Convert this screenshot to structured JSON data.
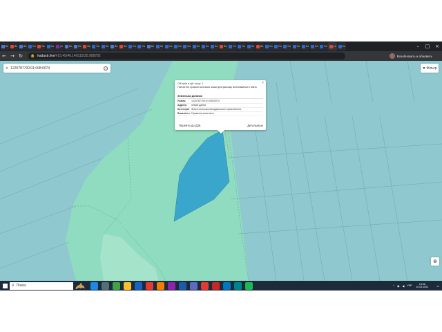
{
  "browser": {
    "tabs": [
      {
        "label": "Ва",
        "color": "#4a7bd6"
      },
      {
        "label": "Ва",
        "color": "#d84a3a"
      },
      {
        "label": "Ва",
        "color": "#4a7bd6"
      },
      {
        "label": "Ка",
        "color": "#2b6ad6"
      },
      {
        "label": "Ва",
        "color": "#d84a3a"
      },
      {
        "label": "Ка",
        "color": "#2b6ad6"
      },
      {
        "label": "Jd",
        "color": "#8e24aa"
      },
      {
        "label": "Ва",
        "color": "#4a7bd6"
      },
      {
        "label": "Ва",
        "color": "#4a7bd6"
      },
      {
        "label": "Ва",
        "color": "#d84a3a"
      },
      {
        "label": "Ка",
        "color": "#2b6ad6"
      },
      {
        "label": "Ка",
        "color": "#2b6ad6"
      },
      {
        "label": "Ва",
        "color": "#4a7bd6"
      },
      {
        "label": "Ва",
        "color": "#d84a3a"
      },
      {
        "label": "Ка",
        "color": "#2b6ad6"
      },
      {
        "label": "Ка",
        "color": "#2b6ad6"
      },
      {
        "label": "Ва",
        "color": "#4a7bd6"
      },
      {
        "label": "Ка",
        "color": "#2b6ad6"
      },
      {
        "label": "Ка",
        "color": "#2b6ad6"
      },
      {
        "label": "Ка",
        "color": "#2b6ad6"
      },
      {
        "label": "Ка",
        "color": "#2b6ad6"
      },
      {
        "label": "Ка",
        "color": "#2b6ad6"
      },
      {
        "label": "Ка",
        "color": "#2b6ad6"
      },
      {
        "label": "Ка",
        "color": "#2b6ad6"
      },
      {
        "label": "Ва",
        "color": "#d84a3a"
      },
      {
        "label": "Кс",
        "color": "#2b6ad6"
      },
      {
        "label": "Ка",
        "color": "#2b6ad6"
      },
      {
        "label": "Ка",
        "color": "#2b6ad6"
      },
      {
        "label": "Ва",
        "color": "#d84a3a"
      },
      {
        "label": "Ка",
        "color": "#2b6ad6"
      },
      {
        "label": "Ка",
        "color": "#2b6ad6"
      },
      {
        "label": "Ка",
        "color": "#2b6ad6"
      },
      {
        "label": "Ка",
        "color": "#2b6ad6"
      },
      {
        "label": "Ка",
        "color": "#2b6ad6"
      },
      {
        "label": "Ка",
        "color": "#2b6ad6"
      },
      {
        "label": "Ка",
        "color": "#2b6ad6"
      },
      {
        "label": "yo",
        "color": "#d84a3a"
      },
      {
        "label": "Ка",
        "color": "#2b6ad6"
      }
    ],
    "url_host": "kadastr.live",
    "url_path": "/#15.45/46.149115/25.908782",
    "profile_label": "Возобновить и обновить"
  },
  "map": {
    "search_value": "1220787700:01:008:0074",
    "filter_label": "Фільтр",
    "colors": {
      "water": "#8fc9cf",
      "green": "#8fdcc0",
      "parcel": "#3aa6cc"
    }
  },
  "popup": {
    "line1": "Об'єктів в цій точці: 1",
    "line2": "Натисніть правою кнопкою миші для фіксації вспливаючого вікна",
    "header": "Земельна ділянка",
    "rows": [
      {
        "k": "Номер",
        "v": "1220787700:01:008:0074"
      },
      {
        "k": "Адреса",
        "v": "немає даних"
      },
      {
        "k": "Категорія",
        "v": "Землі сільськогосподарського призначення"
      },
      {
        "k": "Власність",
        "v": "Приватна власність"
      }
    ],
    "action_left": "Перейти до ДЗК",
    "action_right": "Детальніше"
  },
  "taskbar": {
    "search_placeholder": "Поиск",
    "icons": [
      {
        "name": "edge-icon",
        "color": "#1e88e5"
      },
      {
        "name": "task-view-icon",
        "color": "#546e7a"
      },
      {
        "name": "chrome-icon",
        "color": "#43a047"
      },
      {
        "name": "explorer-icon",
        "color": "#fbc02d"
      },
      {
        "name": "store-icon",
        "color": "#1565c0"
      },
      {
        "name": "app-icon",
        "color": "#e53935"
      },
      {
        "name": "app2-icon",
        "color": "#f57c00"
      },
      {
        "name": "app3-icon",
        "color": "#8e24aa"
      },
      {
        "name": "word-icon",
        "color": "#1e5aa8"
      },
      {
        "name": "teams-icon",
        "color": "#5c6bc0"
      },
      {
        "name": "acrobat-icon",
        "color": "#e53935"
      },
      {
        "name": "app4-icon",
        "color": "#c62828"
      },
      {
        "name": "app5-icon",
        "color": "#0277bd"
      },
      {
        "name": "app6-icon",
        "color": "#00838f"
      },
      {
        "name": "spotify-icon",
        "color": "#1db954"
      }
    ],
    "lang": "УКР",
    "time": "13:06",
    "date": "10.02.2021"
  }
}
